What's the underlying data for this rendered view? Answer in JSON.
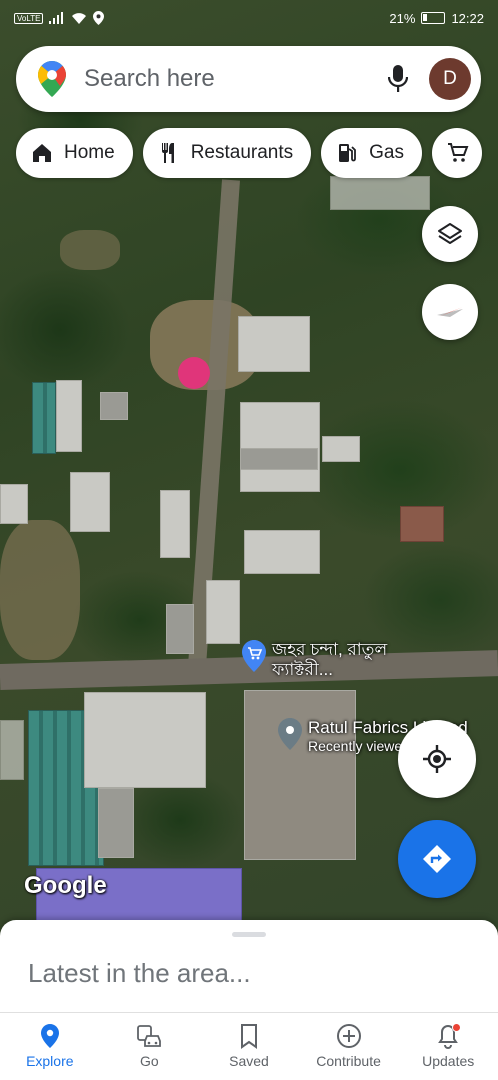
{
  "status_bar": {
    "carrier_chip": "VoLTE",
    "battery_percent": "21%",
    "time": "12:22"
  },
  "search": {
    "placeholder": "Search here",
    "avatar_letter": "D"
  },
  "chips": [
    {
      "label": "Home",
      "icon": "home-icon"
    },
    {
      "label": "Restaurants",
      "icon": "restaurant-icon"
    },
    {
      "label": "Gas",
      "icon": "gas-station-icon"
    },
    {
      "label": "",
      "icon": "shopping-cart-icon"
    }
  ],
  "map": {
    "places": [
      {
        "name_line1": "জহর চন্দা, রাতুল",
        "name_line2": "ফ্যাক্টরী..."
      },
      {
        "name": "Ratul Fabrics Limited",
        "subtitle": "Recently viewed"
      }
    ],
    "watermark": "Google"
  },
  "sheet": {
    "title": "Latest in the area..."
  },
  "nav": {
    "items": [
      {
        "label": "Explore",
        "icon": "explore-pin-icon",
        "active": true
      },
      {
        "label": "Go",
        "icon": "commute-icon"
      },
      {
        "label": "Saved",
        "icon": "bookmark-icon"
      },
      {
        "label": "Contribute",
        "icon": "add-circle-icon"
      },
      {
        "label": "Updates",
        "icon": "bell-icon"
      }
    ]
  },
  "colors": {
    "accent": "#1a73e8",
    "pin_pink": "#e0357a",
    "avatar_bg": "#6d3a2e"
  }
}
